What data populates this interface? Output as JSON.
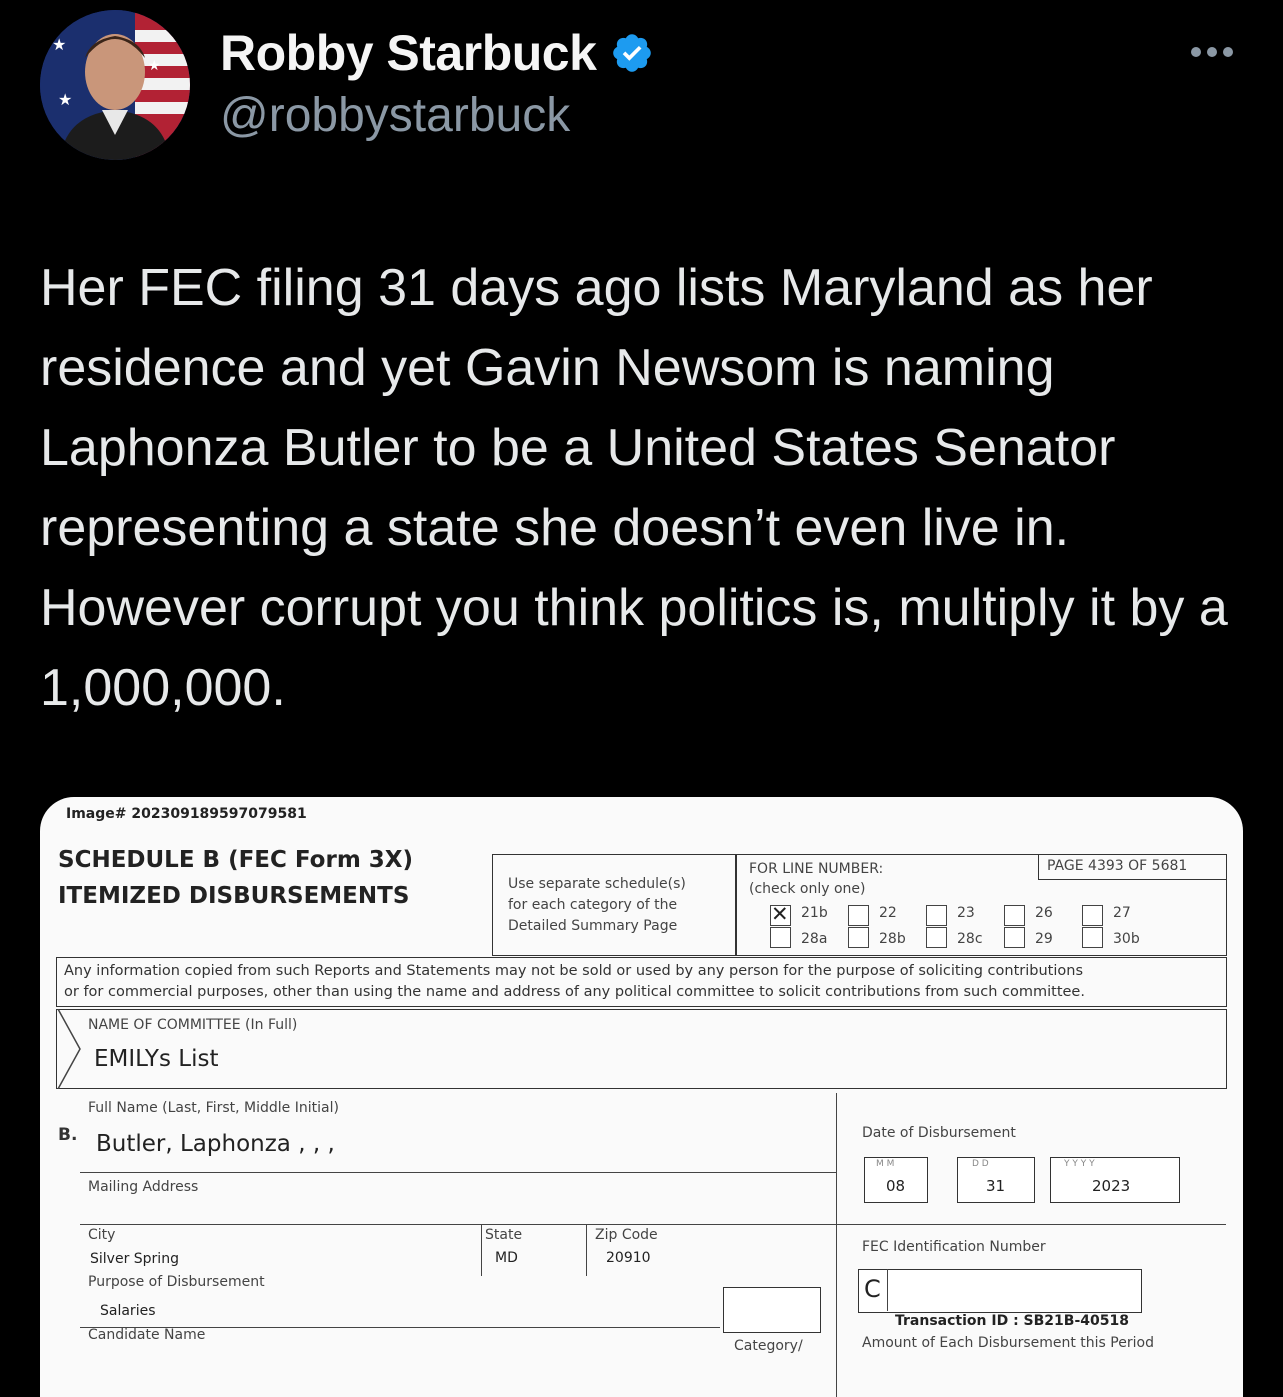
{
  "author": {
    "display_name": "Robby Starbuck",
    "handle": "@robbystarbuck",
    "verified_icon": "verified-badge-icon",
    "avatar": "profile-photo"
  },
  "more_icon": "more-options-icon",
  "tweet_text": "Her FEC filing 31 days ago lists Maryland as her residence and yet Gavin Newsom is naming Laphonza Butler to be a United States Senator representing a state she doesn’t even live in. However corrupt you think politics is, multiply it by a 1,000,000.",
  "document": {
    "image_id": "Image# 202309189597079581",
    "schedule_title": "SCHEDULE B   (FEC Form 3X)",
    "schedule_subtitle": "ITEMIZED DISBURSEMENTS",
    "separate_line1": "Use separate schedule(s)",
    "separate_line2": "for each category of the",
    "separate_line3": "Detailed Summary Page",
    "line_number_label": "FOR LINE NUMBER:",
    "check_only_one": "(check only one)",
    "page_label": "PAGE",
    "page_num": "4393",
    "page_of": "OF",
    "page_total": "5681",
    "checkboxes": [
      {
        "top": "21b",
        "bottom": "28a",
        "checked": true
      },
      {
        "top": "22",
        "bottom": "28b",
        "checked": false
      },
      {
        "top": "23",
        "bottom": "28c",
        "checked": false
      },
      {
        "top": "26",
        "bottom": "29",
        "checked": false
      },
      {
        "top": "27",
        "bottom": "30b",
        "checked": false
      }
    ],
    "notice_line1": "Any information copied from such Reports and Statements may not be sold or used by any person for the purpose of soliciting contributions",
    "notice_line2": "or for commercial purposes, other than using the name and address of any political committee to solicit contributions from such committee.",
    "committee_label": "NAME OF COMMITTEE (In Full)",
    "committee_name": "EMILYs List",
    "section_letter": "B.",
    "full_name_label": "Full Name (Last, First, Middle Initial)",
    "full_name": "Butler, Laphonza , , ,",
    "mailing_label": "Mailing Address",
    "date_label": "Date of Disbursement",
    "date_mm_hint": "M  M",
    "date_dd_hint": "D  D",
    "date_yy_hint": "Y  Y  Y  Y",
    "date_mm": "08",
    "date_dd": "31",
    "date_yyyy": "2023",
    "city_label": "City",
    "city": "Silver Spring",
    "state_label": "State",
    "state": "MD",
    "zip_label": "Zip Code",
    "zip": "20910",
    "fec_id_label": "FEC Identification Number",
    "fec_id_prefix": "C",
    "purpose_label": "Purpose of Disbursement",
    "purpose": "Salaries",
    "candidate_label": "Candidate Name",
    "transaction_id": "Transaction ID : SB21B-40518",
    "category_label": "Category/",
    "amount_label": "Amount of Each Disbursement this Period"
  }
}
